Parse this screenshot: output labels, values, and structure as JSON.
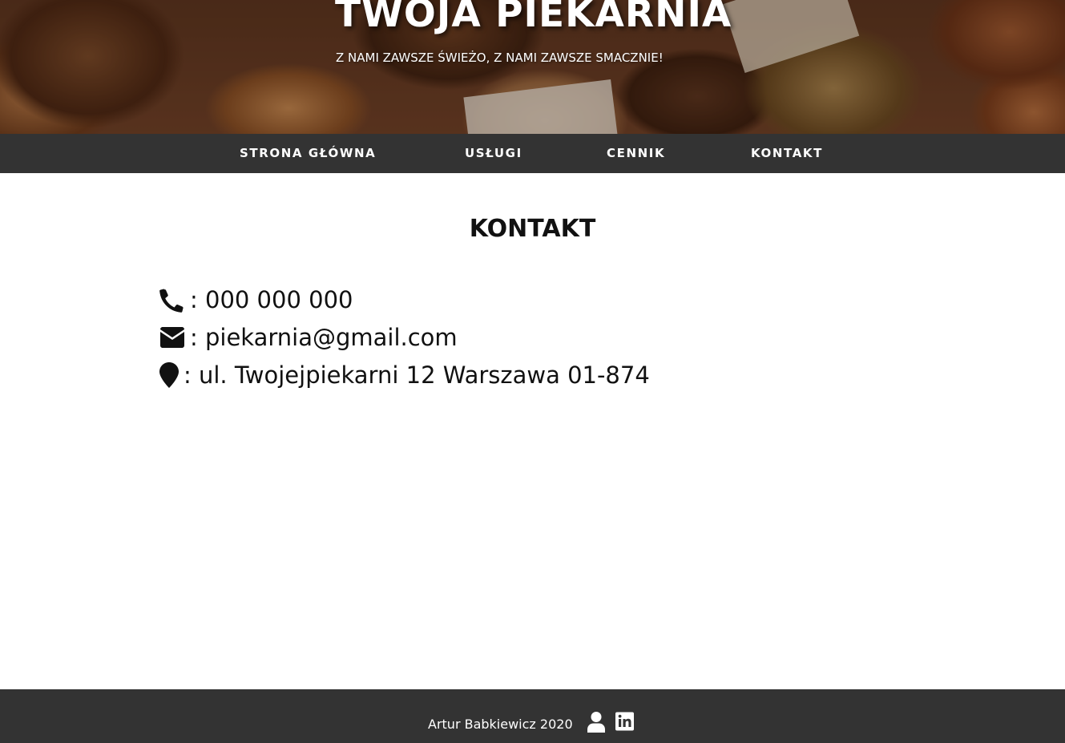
{
  "header": {
    "title": "TWOJA PIEKARNIA",
    "subtitle": "Z NAMI ZAWSZE ŚWIEŻO, Z NAMI ZAWSZE SMACZNIE!",
    "background": "bread-photo"
  },
  "nav": {
    "items": [
      {
        "label": "STRONA GŁÓWNA"
      },
      {
        "label": "USŁUGI"
      },
      {
        "label": "CENNIK"
      },
      {
        "label": "KONTAKT"
      }
    ]
  },
  "main": {
    "title": "KONTAKT",
    "contacts": [
      {
        "icon": "phone-icon",
        "text": ": 000 000 000"
      },
      {
        "icon": "envelope-icon",
        "text": ": piekarnia@gmail.com"
      },
      {
        "icon": "map-marker-icon",
        "text": ": ul. Twojejpiekarni 12 Warszawa 01-874"
      }
    ]
  },
  "footer": {
    "text": "Artur Babkiewicz 2020",
    "icons": [
      "user-icon",
      "linkedin-icon"
    ]
  },
  "colors": {
    "nav_background": "#333333",
    "footer_background": "#333333",
    "text": "#111111",
    "nav_text": "#ffffff"
  }
}
